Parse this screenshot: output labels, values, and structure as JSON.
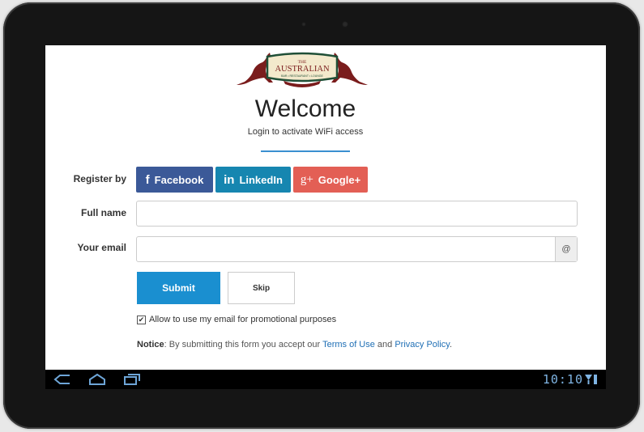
{
  "logo": {
    "line1": "THE",
    "line2": "AUSTRALIAN",
    "line3": "BAR • RESTAURANT • LOUNGE",
    "colors": {
      "kangaroo": "#7a1c1c",
      "border": "#1f4f37",
      "banner": "#f3e9cc"
    }
  },
  "header": {
    "title": "Welcome",
    "subtitle": "Login to activate WiFi access"
  },
  "form": {
    "register_label": "Register by",
    "social": [
      {
        "label": "Facebook",
        "icon": "facebook-icon",
        "glyph": "f",
        "color": "#3b5998"
      },
      {
        "label": "LinkedIn",
        "icon": "linkedin-icon",
        "glyph": "in",
        "color": "#1686b0"
      },
      {
        "label": "Google+",
        "icon": "google-plus-icon",
        "glyph": "g+",
        "color": "#e35f55"
      }
    ],
    "fullname_label": "Full name",
    "fullname_value": "",
    "email_label": "Your email",
    "email_value": "",
    "email_addon": "@",
    "submit_label": "Submit",
    "skip_label": "Skip",
    "promo_check_glyph": "✔",
    "promo_label": "Allow to use my email for promotional purposes",
    "notice_prefix": "Notice",
    "notice_text": ": By submitting this form you accept our ",
    "terms_link": "Terms of Use",
    "notice_and": " and ",
    "privacy_link": "Privacy Policy",
    "notice_end": "."
  },
  "statusbar": {
    "time": "10:10",
    "accent": "#7fb4e3",
    "nav_icons": [
      "back-icon",
      "home-icon",
      "recent-apps-icon"
    ],
    "status_icons": [
      "wifi-signal-icon",
      "battery-icon"
    ]
  }
}
